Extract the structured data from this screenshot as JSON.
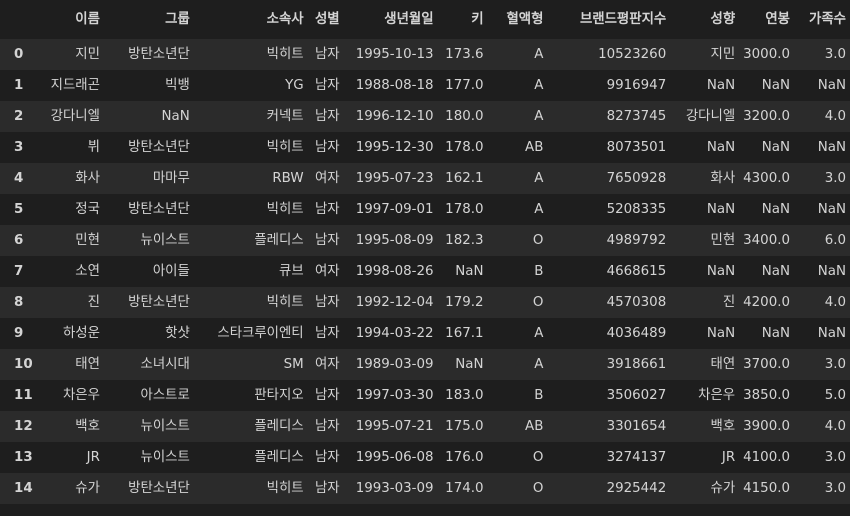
{
  "columns": [
    "",
    "이름",
    "그룹",
    "소속사",
    "성별",
    "생년월일",
    "키",
    "혈액형",
    "브랜드평판지수",
    "성향",
    "연봉",
    "가족수"
  ],
  "rows": [
    {
      "idx": "0",
      "name": "지민",
      "group": "방탄소년단",
      "agency": "빅히트",
      "gender": "남자",
      "birth": "1995-10-13",
      "height": "173.6",
      "blood": "A",
      "brand": "10523260",
      "status": "지민",
      "salary": "3000.0",
      "family": "3.0"
    },
    {
      "idx": "1",
      "name": "지드래곤",
      "group": "빅뱅",
      "agency": "YG",
      "gender": "남자",
      "birth": "1988-08-18",
      "height": "177.0",
      "blood": "A",
      "brand": "9916947",
      "status": "NaN",
      "salary": "NaN",
      "family": "NaN"
    },
    {
      "idx": "2",
      "name": "강다니엘",
      "group": "NaN",
      "agency": "커넥트",
      "gender": "남자",
      "birth": "1996-12-10",
      "height": "180.0",
      "blood": "A",
      "brand": "8273745",
      "status": "강다니엘",
      "salary": "3200.0",
      "family": "4.0"
    },
    {
      "idx": "3",
      "name": "뷔",
      "group": "방탄소년단",
      "agency": "빅히트",
      "gender": "남자",
      "birth": "1995-12-30",
      "height": "178.0",
      "blood": "AB",
      "brand": "8073501",
      "status": "NaN",
      "salary": "NaN",
      "family": "NaN"
    },
    {
      "idx": "4",
      "name": "화사",
      "group": "마마무",
      "agency": "RBW",
      "gender": "여자",
      "birth": "1995-07-23",
      "height": "162.1",
      "blood": "A",
      "brand": "7650928",
      "status": "화사",
      "salary": "4300.0",
      "family": "3.0"
    },
    {
      "idx": "5",
      "name": "정국",
      "group": "방탄소년단",
      "agency": "빅히트",
      "gender": "남자",
      "birth": "1997-09-01",
      "height": "178.0",
      "blood": "A",
      "brand": "5208335",
      "status": "NaN",
      "salary": "NaN",
      "family": "NaN"
    },
    {
      "idx": "6",
      "name": "민현",
      "group": "뉴이스트",
      "agency": "플레디스",
      "gender": "남자",
      "birth": "1995-08-09",
      "height": "182.3",
      "blood": "O",
      "brand": "4989792",
      "status": "민현",
      "salary": "3400.0",
      "family": "6.0"
    },
    {
      "idx": "7",
      "name": "소연",
      "group": "아이들",
      "agency": "큐브",
      "gender": "여자",
      "birth": "1998-08-26",
      "height": "NaN",
      "blood": "B",
      "brand": "4668615",
      "status": "NaN",
      "salary": "NaN",
      "family": "NaN"
    },
    {
      "idx": "8",
      "name": "진",
      "group": "방탄소년단",
      "agency": "빅히트",
      "gender": "남자",
      "birth": "1992-12-04",
      "height": "179.2",
      "blood": "O",
      "brand": "4570308",
      "status": "진",
      "salary": "4200.0",
      "family": "4.0"
    },
    {
      "idx": "9",
      "name": "하성운",
      "group": "핫샷",
      "agency": "스타크루이엔티",
      "gender": "남자",
      "birth": "1994-03-22",
      "height": "167.1",
      "blood": "A",
      "brand": "4036489",
      "status": "NaN",
      "salary": "NaN",
      "family": "NaN"
    },
    {
      "idx": "10",
      "name": "태연",
      "group": "소녀시대",
      "agency": "SM",
      "gender": "여자",
      "birth": "1989-03-09",
      "height": "NaN",
      "blood": "A",
      "brand": "3918661",
      "status": "태연",
      "salary": "3700.0",
      "family": "3.0"
    },
    {
      "idx": "11",
      "name": "차은우",
      "group": "아스트로",
      "agency": "판타지오",
      "gender": "남자",
      "birth": "1997-03-30",
      "height": "183.0",
      "blood": "B",
      "brand": "3506027",
      "status": "차은우",
      "salary": "3850.0",
      "family": "5.0"
    },
    {
      "idx": "12",
      "name": "백호",
      "group": "뉴이스트",
      "agency": "플레디스",
      "gender": "남자",
      "birth": "1995-07-21",
      "height": "175.0",
      "blood": "AB",
      "brand": "3301654",
      "status": "백호",
      "salary": "3900.0",
      "family": "4.0"
    },
    {
      "idx": "13",
      "name": "JR",
      "group": "뉴이스트",
      "agency": "플레디스",
      "gender": "남자",
      "birth": "1995-06-08",
      "height": "176.0",
      "blood": "O",
      "brand": "3274137",
      "status": "JR",
      "salary": "4100.0",
      "family": "3.0"
    },
    {
      "idx": "14",
      "name": "슈가",
      "group": "방탄소년단",
      "agency": "빅히트",
      "gender": "남자",
      "birth": "1993-03-09",
      "height": "174.0",
      "blood": "O",
      "brand": "2925442",
      "status": "슈가",
      "salary": "4150.0",
      "family": "3.0"
    }
  ]
}
